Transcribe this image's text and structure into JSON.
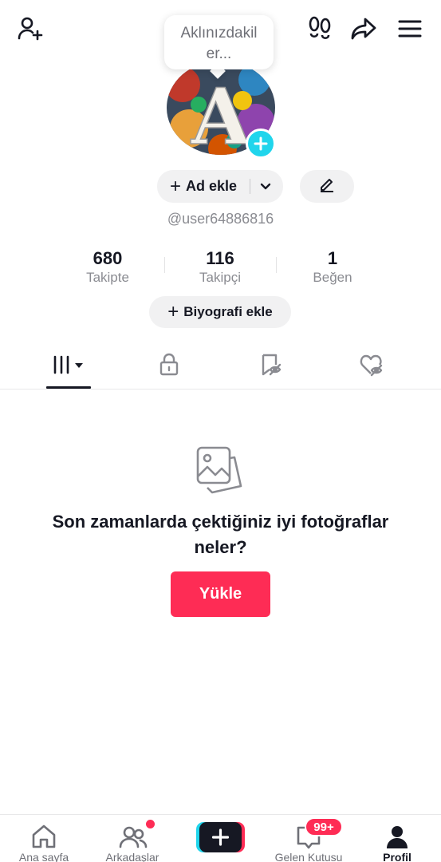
{
  "header": {
    "icons": [
      "add-user-icon",
      "footprints-icon",
      "share-icon",
      "menu-icon"
    ]
  },
  "bubble": {
    "text": "Aklınızdakil er..."
  },
  "profile": {
    "avatar_letter": "A",
    "add_name_label": "Ad ekle",
    "username": "@user64886816",
    "bio_label": "Biyografi ekle"
  },
  "stats": [
    {
      "value": "680",
      "label": "Takipte"
    },
    {
      "value": "116",
      "label": "Takipçi"
    },
    {
      "value": "1",
      "label": "Beğen"
    }
  ],
  "tabs": [
    {
      "name": "videos",
      "icon": "grid-icon",
      "active": true
    },
    {
      "name": "private",
      "icon": "lock-icon",
      "active": false
    },
    {
      "name": "favorites",
      "icon": "bookmark-hidden-icon",
      "active": false
    },
    {
      "name": "liked",
      "icon": "heart-hidden-icon",
      "active": false
    }
  ],
  "empty_state": {
    "title": "Son zamanlarda çektiğiniz iyi fotoğraflar neler?",
    "button": "Yükle"
  },
  "nav": {
    "home": "Ana sayfa",
    "friends": "Arkadaşlar",
    "inbox": "Gelen Kutusu",
    "inbox_badge": "99+",
    "profile": "Profil"
  },
  "colors": {
    "accent": "#fe2c55",
    "cyan": "#20d5ec",
    "text": "#161823",
    "secondary": "#8a8b91"
  }
}
